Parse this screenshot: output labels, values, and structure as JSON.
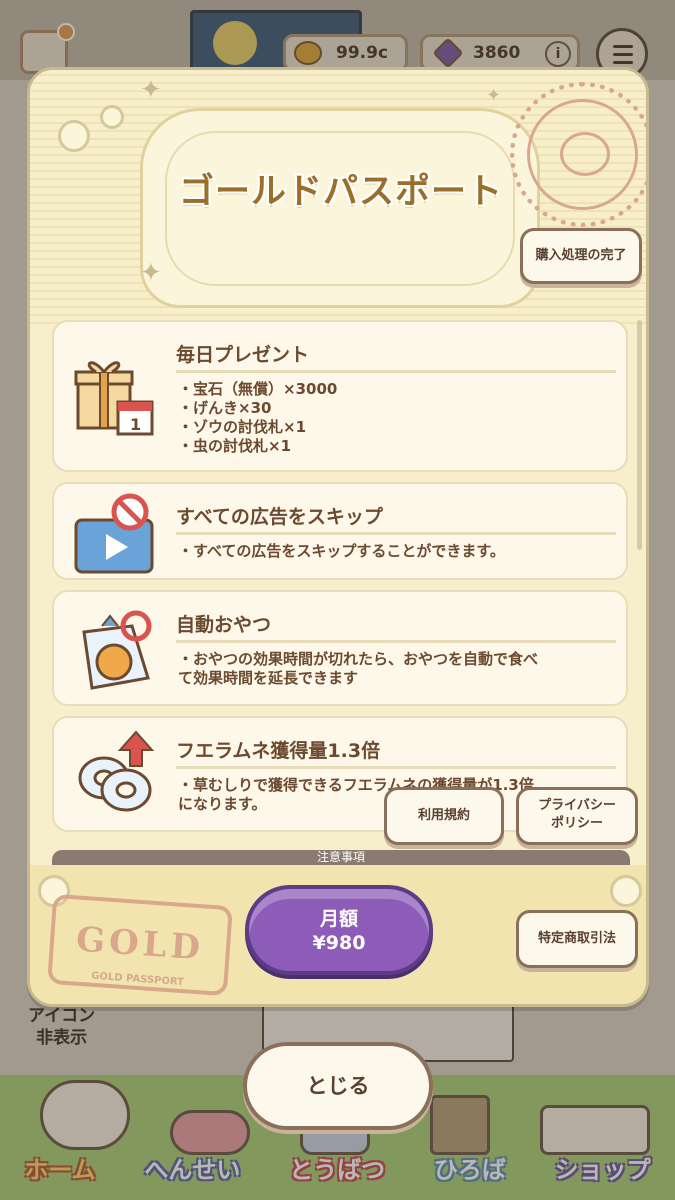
{
  "hud": {
    "coins": "99.9c",
    "gems": "3860",
    "plus_label": "i"
  },
  "background": {
    "hide_icon_label_1": "アイコン",
    "hide_icon_label_2": "非表示"
  },
  "tabs": [
    {
      "label": "ホーム",
      "icon": "home-icon"
    },
    {
      "label": "へんせい",
      "icon": "formation-icon"
    },
    {
      "label": "とうばつ",
      "icon": "subjugation-icon"
    },
    {
      "label": "ひろば",
      "icon": "plaza-icon"
    },
    {
      "label": "ショップ",
      "icon": "shop-icon"
    }
  ],
  "modal": {
    "title": "ゴールドパスポート",
    "complete_purchase": "購入処理の完了",
    "benefits": [
      {
        "title": "毎日プレゼント",
        "icon": "gift-calendar-icon",
        "lines": [
          "・宝石（無償）×3000",
          "・げんき×30",
          "・ゾウの討伐札×1",
          "・虫の討伐札×1"
        ]
      },
      {
        "title": "すべての広告をスキップ",
        "icon": "ad-skip-icon",
        "lines": [
          "・すべての広告をスキップすることができます。"
        ]
      },
      {
        "title": "自動おやつ",
        "icon": "auto-snack-icon",
        "lines": [
          "・おやつの効果時間が切れたら、おやつを自動で食べ",
          "て効果時間を延長できます"
        ]
      },
      {
        "title": "フエラムネ獲得量1.3倍",
        "icon": "fuerame-up-icon",
        "lines": [
          "・草むしりで獲得できるフエラムネの獲得量が1.3倍",
          "になります。"
        ]
      }
    ],
    "notice_label": "注意事項",
    "terms": "利用規約",
    "privacy_1": "プライバシー",
    "privacy_2": "ポリシー",
    "stamp_gold": "GOLD",
    "stamp_passport": "GOLD PASSPORT",
    "price_line_1": "月額",
    "price_line_2": "¥980",
    "commercial_law": "特定商取引法"
  },
  "close_label": "とじる"
}
